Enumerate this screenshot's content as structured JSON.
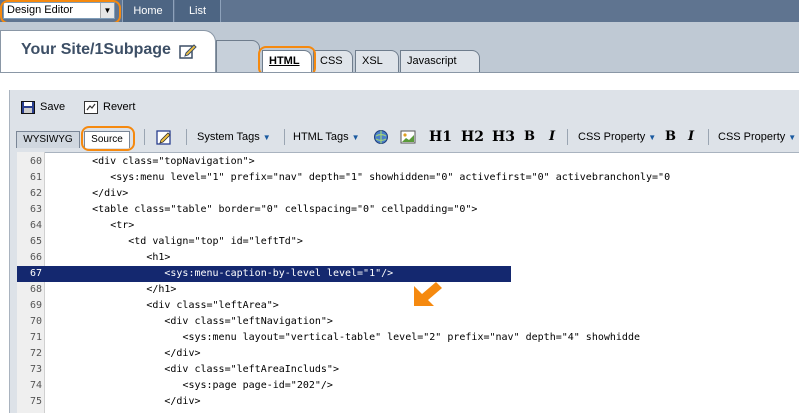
{
  "topbar": {
    "mode_select": "Design Editor",
    "nav": [
      "Home",
      "List"
    ]
  },
  "page": {
    "title": "Your Site/1Subpage",
    "file_tabs": [
      "HTML",
      "CSS",
      "XSL",
      "Javascript"
    ]
  },
  "actions": {
    "save_label": "Save",
    "revert_label": "Revert"
  },
  "toolbar": {
    "view_tabs": [
      "WYSIWYG",
      "Source"
    ],
    "system_tags": "System Tags",
    "html_tags": "HTML Tags",
    "h1": "H1",
    "h2": "H2",
    "h3": "H3",
    "bold": "B",
    "italic": "I",
    "css_property_1": "CSS Property",
    "bold2": "B",
    "italic2": "I",
    "css_property_2": "CSS Property"
  },
  "code": {
    "selected_line": 67,
    "lines": [
      {
        "num": "60",
        "indent": 7,
        "text": "<div class=\"topNavigation\">"
      },
      {
        "num": "61",
        "indent": 10,
        "text": "<sys:menu level=\"1\" prefix=\"nav\" depth=\"1\" showhidden=\"0\" activefirst=\"0\" activebranchonly=\"0"
      },
      {
        "num": "62",
        "indent": 7,
        "text": "</div>"
      },
      {
        "num": "63",
        "indent": 7,
        "text": "<table class=\"table\" border=\"0\" cellspacing=\"0\" cellpadding=\"0\">"
      },
      {
        "num": "64",
        "indent": 10,
        "text": "<tr>"
      },
      {
        "num": "65",
        "indent": 13,
        "text": "<td valign=\"top\" id=\"leftTd\">"
      },
      {
        "num": "66",
        "indent": 16,
        "text": "<h1>"
      },
      {
        "num": "67",
        "indent": 19,
        "text": "<sys:menu-caption-by-level level=\"1\"/>"
      },
      {
        "num": "68",
        "indent": 16,
        "text": "</h1>"
      },
      {
        "num": "69",
        "indent": 16,
        "text": "<div class=\"leftArea\">"
      },
      {
        "num": "70",
        "indent": 19,
        "text": "<div class=\"leftNavigation\">"
      },
      {
        "num": "71",
        "indent": 22,
        "text": "<sys:menu layout=\"vertical-table\" level=\"2\" prefix=\"nav\" depth=\"4\" showhidde"
      },
      {
        "num": "72",
        "indent": 19,
        "text": "</div>"
      },
      {
        "num": "73",
        "indent": 19,
        "text": "<div class=\"leftAreaIncluds\">"
      },
      {
        "num": "74",
        "indent": 22,
        "text": "<sys:page page-id=\"202\"/>"
      },
      {
        "num": "75",
        "indent": 19,
        "text": "</div>"
      }
    ]
  },
  "colors": {
    "highlight": "#f5890f",
    "selection": "#14286f",
    "topbar": "#5f7490"
  }
}
